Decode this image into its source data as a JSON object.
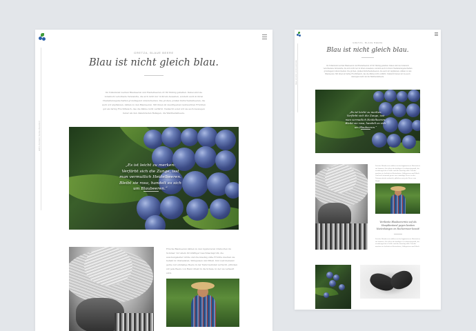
{
  "large": {
    "kicker": "GRETZA, BLAUE BEERE",
    "title": "Blau ist nicht gleich blau.",
    "side_text": "WAHLHEIMER HEIDELBEEREN",
    "intro": "Im Volksmund werden Blaubeeren und Heidelbeeren oft für fünfzig gehalten. Dabei sind sie botanisch verschiede­ Verwandte, die sich nicht nur in ihrem Aussehen, sondern auch in ihren Charaktereigenschaften grundlegend unterscheiden. Die großen, prallen Kulturheidelbeeren, die auch wir anpflanzen, zählen zu den Blaubeeren. Mit ihnen ist Ausdrigesten Gebrauchten Früchten gut als farbig Fruchtfleisch, das die Zähne nicht verfärbt. Vielleicht sonst wir sie auch deswegen lieber als den dieleinrasten Beilagen, die Waldheidelbeere.",
    "quote": "„Es ist leicht zu merken: Verfärbt sich die Zunge, isst man vermutlich Heidelbeeren. Bleibt sie rosa, handelt es sich um Blaubeeren.“",
    "body": "Frische Blaubeeren zählen zu den bppinoteren Obstsorten im Sommer. Vor allem ihr kräftiger Geschmacksprofil, die ausobengeleiter Größe und die knackig süße Früchte machen sie beliebt in Obstsalaten, Süßspeisen und Müsli. Und weil niemand gerne nur einmalige Beere in der Naturweitstab verbucht, pflücken wir jede Beere von Hand direkt in die Schale, in der sie verkauft wird."
  },
  "small": {
    "kicker": "GRETZA, BLAUE BEERE",
    "title": "Blau ist nicht gleich blau.",
    "side_text": "WAHLHEIMER HEIDELBEEREN",
    "intro": "Im Volksmund werden Blaubeeren und Heidelbeeren oft für fünfzig gehalten. Dabei sind sie botanisch verschiedene Verwandte, die sich nicht nur in ihrem Aussehen, sondern auch in ihren Charaktereigenschaften grundlegend unterscheiden. Die großen, prallen Kulturheidelbeeren, die auch wir anpflanzen, zählen zu den Blaubeeren. Mit ihnen ist farbig Fruchtfleisch, das die Zähne nicht verfärbt. Vielleicht lieben wir sie auch deswegen mehr als die Waldheidelbeere.",
    "quote": "„Es ist leicht zu merken: Verfärbt sich die Zunge, isst man vermutlich Heidelbeeren. Bleibt sie rosa, handelt es sich um Blaubeeren.“",
    "body1": "Frische Blaubeeren zählen zu den bppinoteren Obstsorten im Sommer. Vor allem ihr kräftiger Geschmacksprofil, die ausobengeleiter Größe und die knackig süße Früchte machen sie beliebt in Obstsalaten, Süßspeisen und Müsli. Und weil niemand gerne nur einmalige Beere in der Naturweitstab verbucht, pflücken wir jede Beere von Hand.",
    "caption": "Verdiente Blaubeerernte auf als Hauptbestand gegen bestien Nietenhängen im Rochermoor bossit!",
    "body2": "Frische Blaubeeren zählen zu den bppinoteren Obstsorten im Sommer. Vor allem ihr kräftiger Geschmacksprofil, die ausobengeleiter Größe und die knackig süße Früchte machen sie beliebt in Obstsalaten, Süßspeisen und Müsli."
  },
  "icons": {
    "logo": "blueberry-leaf-logo",
    "menu": "hamburger-menu-icon"
  },
  "colors": {
    "background": "#e3e6ea",
    "page": "#ffffff",
    "accent_green": "#3f9b3a",
    "accent_blue": "#2b5fa8"
  }
}
